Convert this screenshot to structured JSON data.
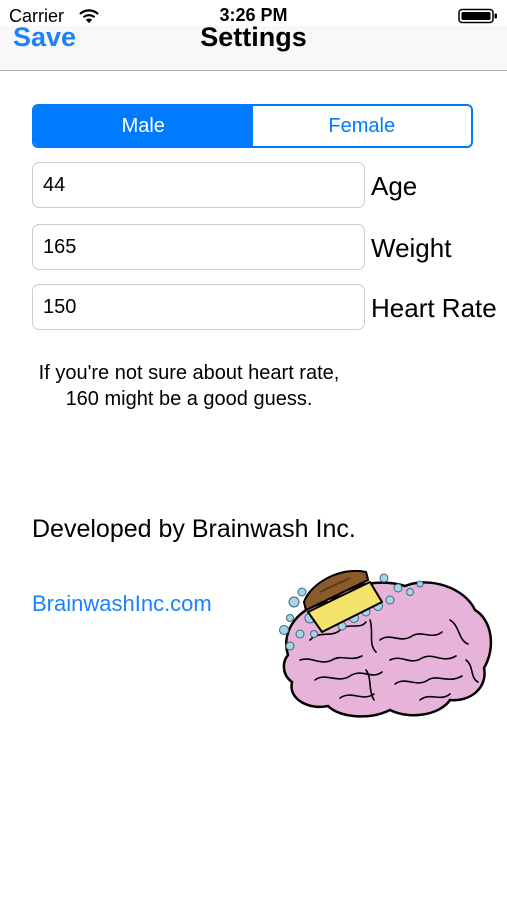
{
  "status": {
    "carrier": "Carrier",
    "time": "3:26 PM"
  },
  "nav": {
    "save_label": "Save",
    "title": "Settings"
  },
  "gender": {
    "options": [
      "Male",
      "Female"
    ],
    "selected": "Male"
  },
  "fields": [
    {
      "value": "44",
      "label": "Age"
    },
    {
      "value": "165",
      "label": "Weight"
    },
    {
      "value": "150",
      "label": "Heart Rate"
    }
  ],
  "hint": {
    "line1": "If you're not sure about heart rate,",
    "line2": "160 might be a good guess."
  },
  "developer": "Developed by Brainwash Inc.",
  "website": "BrainwashInc.com",
  "colors": {
    "accent": "#007aff",
    "link": "#1a82fb",
    "brain": "#e8b3d9",
    "brush_band": "#f4e46b",
    "brush_handle": "#8b5a2b",
    "bubbles": "#a9d3e6"
  },
  "icons": [
    "wifi-icon",
    "battery-icon",
    "brainwash-logo"
  ]
}
